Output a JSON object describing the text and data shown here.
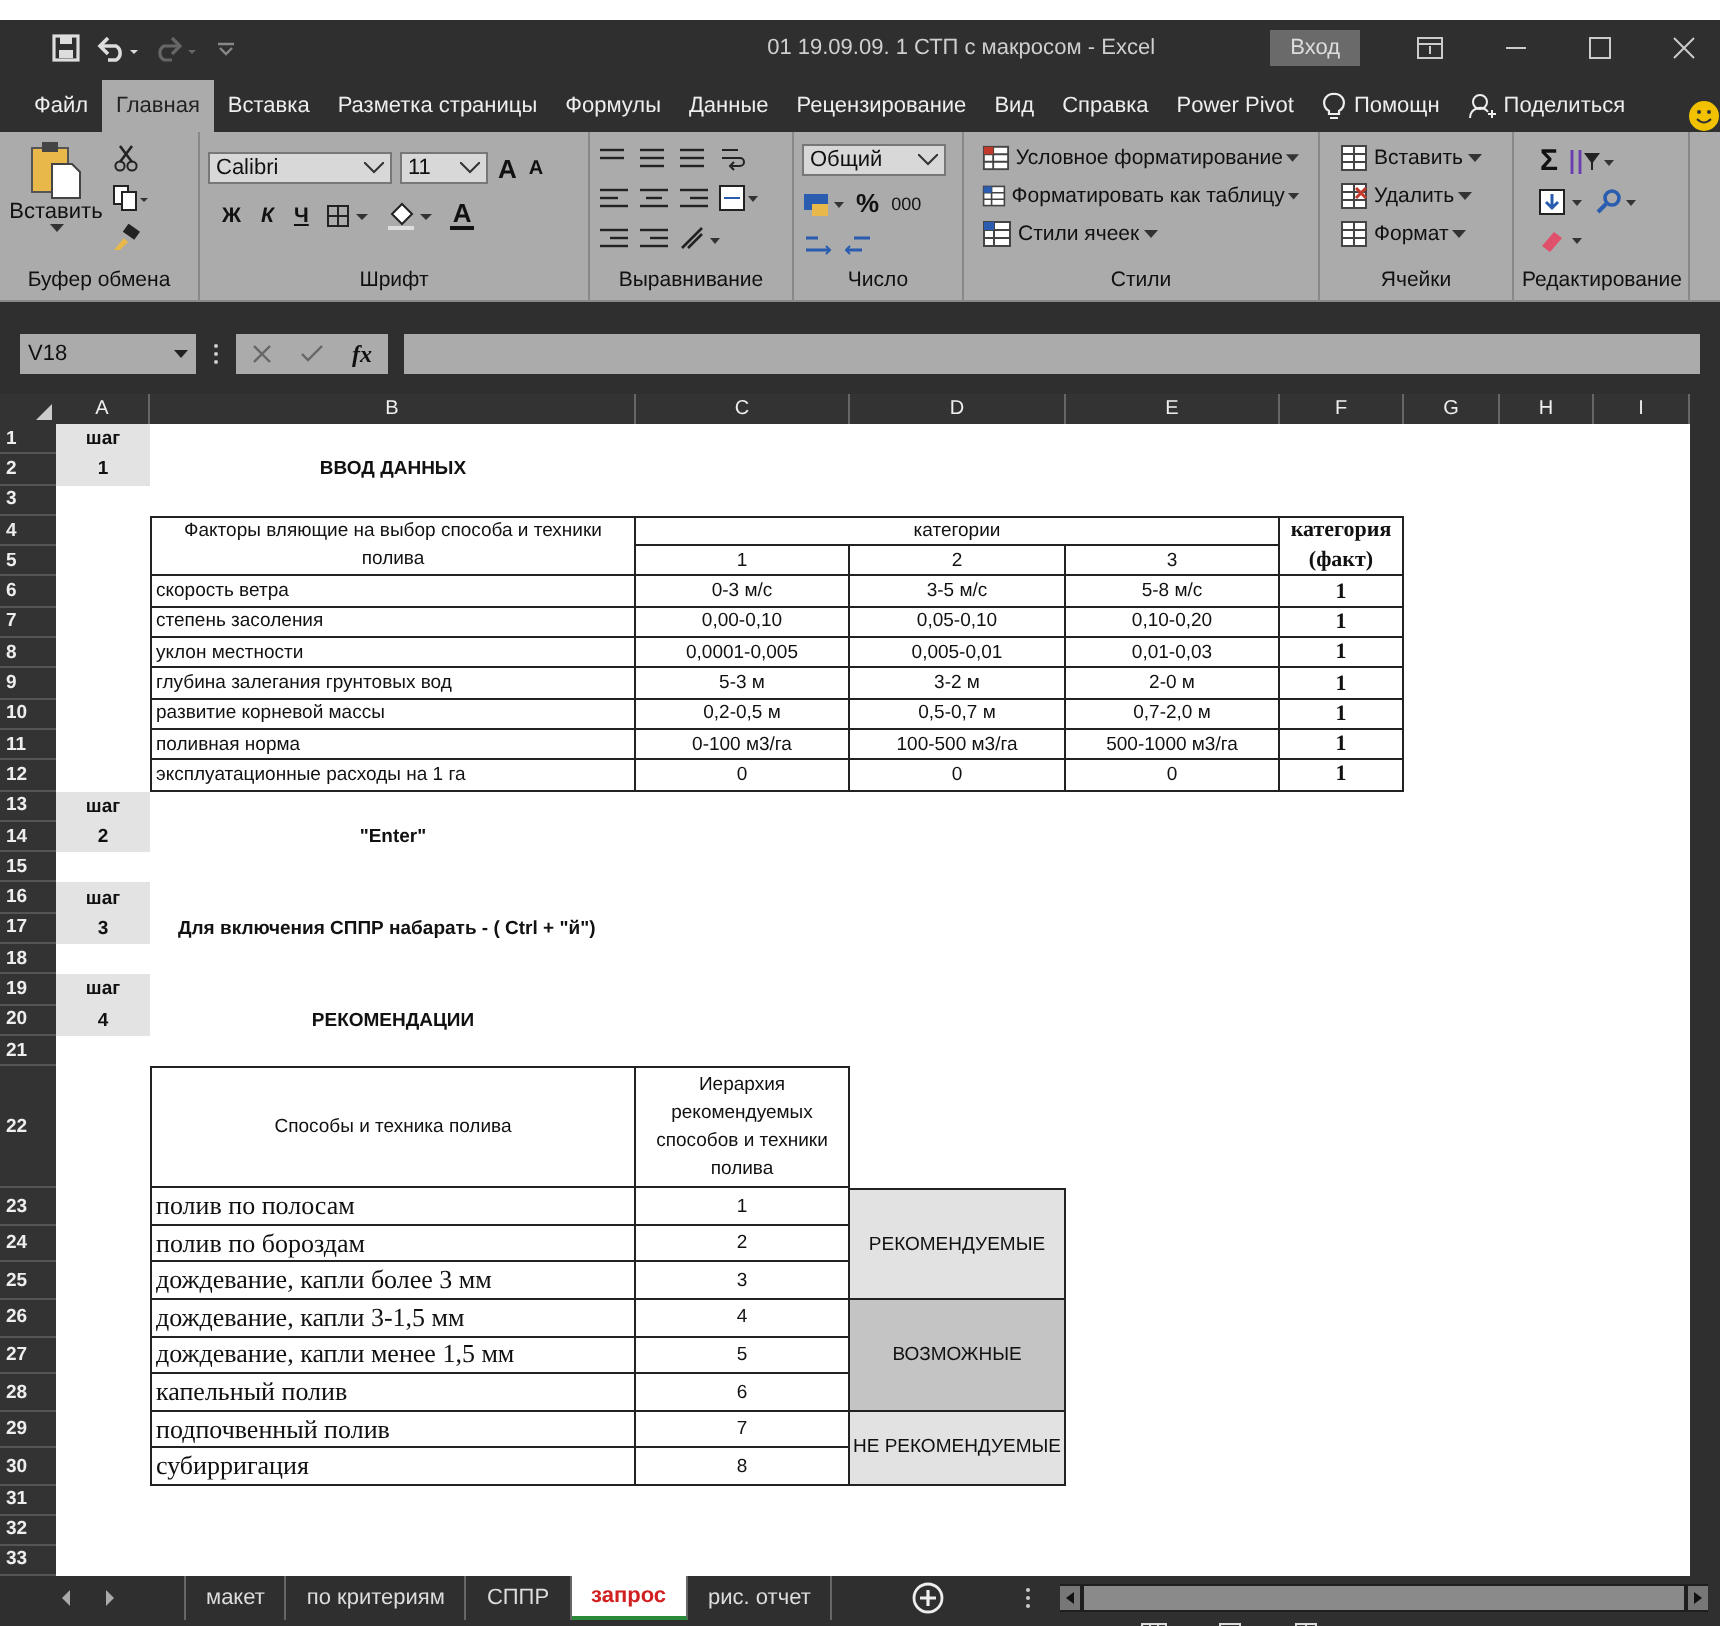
{
  "window": {
    "title": "01 19.09.09. 1 СТП с макросом  -  Excel",
    "sign_in": "Вход"
  },
  "menu": {
    "tabs": [
      {
        "label": "Файл",
        "selected": false
      },
      {
        "label": "Главная",
        "selected": true
      },
      {
        "label": "Вставка",
        "selected": false
      },
      {
        "label": "Разметка страницы",
        "selected": false
      },
      {
        "label": "Формулы",
        "selected": false
      },
      {
        "label": "Данные",
        "selected": false
      },
      {
        "label": "Рецензирование",
        "selected": false
      },
      {
        "label": "Вид",
        "selected": false
      },
      {
        "label": "Справка",
        "selected": false
      },
      {
        "label": "Power Pivot",
        "selected": false
      }
    ],
    "tell_me": "Помощн",
    "share": "Поделиться"
  },
  "ribbon": {
    "clipboard": {
      "paste": "Вставить",
      "label": "Буфер обмена"
    },
    "font": {
      "name": "Calibri",
      "size": "11",
      "grow": "A",
      "shrink": "A",
      "bold": "Ж",
      "italic": "К",
      "underline": "Ч",
      "font_color": "А",
      "label": "Шрифт"
    },
    "alignment": {
      "label": "Выравнивание"
    },
    "number": {
      "format": "Общий",
      "percent": "%",
      "thousands": "000",
      "label": "Число"
    },
    "styles": {
      "items": [
        "Условное форматирование",
        "Форматировать как таблицу",
        "Стили ячеек"
      ],
      "label": "Стили"
    },
    "cells": {
      "items": [
        "Вставить",
        "Удалить",
        "Формат"
      ],
      "label": "Ячейки"
    },
    "editing": {
      "sum": "Σ",
      "label": "Редактирование"
    }
  },
  "formula_bar": {
    "name_box": "V18",
    "fx": "fx"
  },
  "sheet": {
    "columns": [
      "A",
      "B",
      "C",
      "D",
      "E",
      "F",
      "G",
      "H",
      "I"
    ],
    "rows": [
      "1",
      "2",
      "3",
      "4",
      "5",
      "6",
      "7",
      "8",
      "9",
      "10",
      "11",
      "12",
      "13",
      "14",
      "15",
      "16",
      "17",
      "18",
      "19",
      "20",
      "21",
      "22",
      "23",
      "24",
      "25",
      "26",
      "27",
      "28",
      "29",
      "30",
      "31",
      "32",
      "33"
    ],
    "steps": [
      {
        "label": "шаг",
        "number": "1"
      },
      {
        "label": "шаг",
        "number": "2"
      },
      {
        "label": "шаг",
        "number": "3"
      },
      {
        "label": "шаг",
        "number": "4"
      }
    ],
    "headings": [
      "ВВОД ДАННЫХ",
      "\"Enter\"",
      "Для включения СППР набарать  - ( Ctrl + \"й\")",
      "РЕКОМЕНДАЦИИ"
    ],
    "input_table": {
      "factor_header": "Факторы вляющие на выбор способа и техники полива",
      "categories_header": "категории",
      "category_numbers": [
        "1",
        "2",
        "3"
      ],
      "fact_header": "категория (факт)",
      "rows": [
        {
          "factor": "скорость ветра",
          "values": [
            "0-3 м/с",
            "3-5 м/с",
            "5-8 м/с"
          ],
          "fact": "1"
        },
        {
          "factor": "степень засоления",
          "values": [
            "0,00-0,10",
            "0,05-0,10",
            "0,10-0,20"
          ],
          "fact": "1"
        },
        {
          "factor": "уклон местности",
          "values": [
            "0,0001-0,005",
            "0,005-0,01",
            "0,01-0,03"
          ],
          "fact": "1"
        },
        {
          "factor": "глубина залегания грунтовых вод",
          "values": [
            "5-3 м",
            "3-2 м",
            "2-0 м"
          ],
          "fact": "1"
        },
        {
          "factor": "развитие корневой массы",
          "values": [
            "0,2-0,5 м",
            "0,5-0,7 м",
            "0,7-2,0 м"
          ],
          "fact": "1"
        },
        {
          "factor": "поливная норма",
          "values": [
            "0-100 м3/га",
            "100-500 м3/га",
            "500-1000 м3/га"
          ],
          "fact": "1"
        },
        {
          "factor": "эксплуатационные расходы на 1 га",
          "values": [
            "0",
            "0",
            "0"
          ],
          "fact": "1"
        }
      ]
    },
    "recommendations": {
      "method_header": "Способы и техника полива",
      "rank_header": "Иерархия рекомендуемых способов и техники полива",
      "groups": [
        {
          "label": "РЕКОМЕНДУЕМЫЕ",
          "color": "#e2e2e2",
          "methods": [
            {
              "method": "полив по полосам",
              "rank": "1"
            },
            {
              "method": "полив по бороздам",
              "rank": "2"
            },
            {
              "method": "дождевание, капли более 3 мм",
              "rank": "3"
            }
          ]
        },
        {
          "label": "ВОЗМОЖНЫЕ",
          "color": "#c4c4c4",
          "methods": [
            {
              "method": "дождевание, капли 3-1,5 мм",
              "rank": "4"
            },
            {
              "method": "дождевание, капли менее 1,5 мм",
              "rank": "5"
            },
            {
              "method": "капельный полив",
              "rank": "6"
            }
          ]
        },
        {
          "label": "НЕ РЕКОМЕНДУЕМЫЕ",
          "color": "#e2e2e2",
          "methods": [
            {
              "method": "подпочвенный полив",
              "rank": "7"
            },
            {
              "method": "субирригация",
              "rank": "8"
            }
          ]
        }
      ]
    }
  },
  "sheet_tabs": [
    {
      "label": "макет",
      "selected": false
    },
    {
      "label": "по критериям",
      "selected": false
    },
    {
      "label": "СППР",
      "selected": false
    },
    {
      "label": "запрос",
      "selected": true
    },
    {
      "label": "рис. отчет",
      "selected": false
    }
  ]
}
